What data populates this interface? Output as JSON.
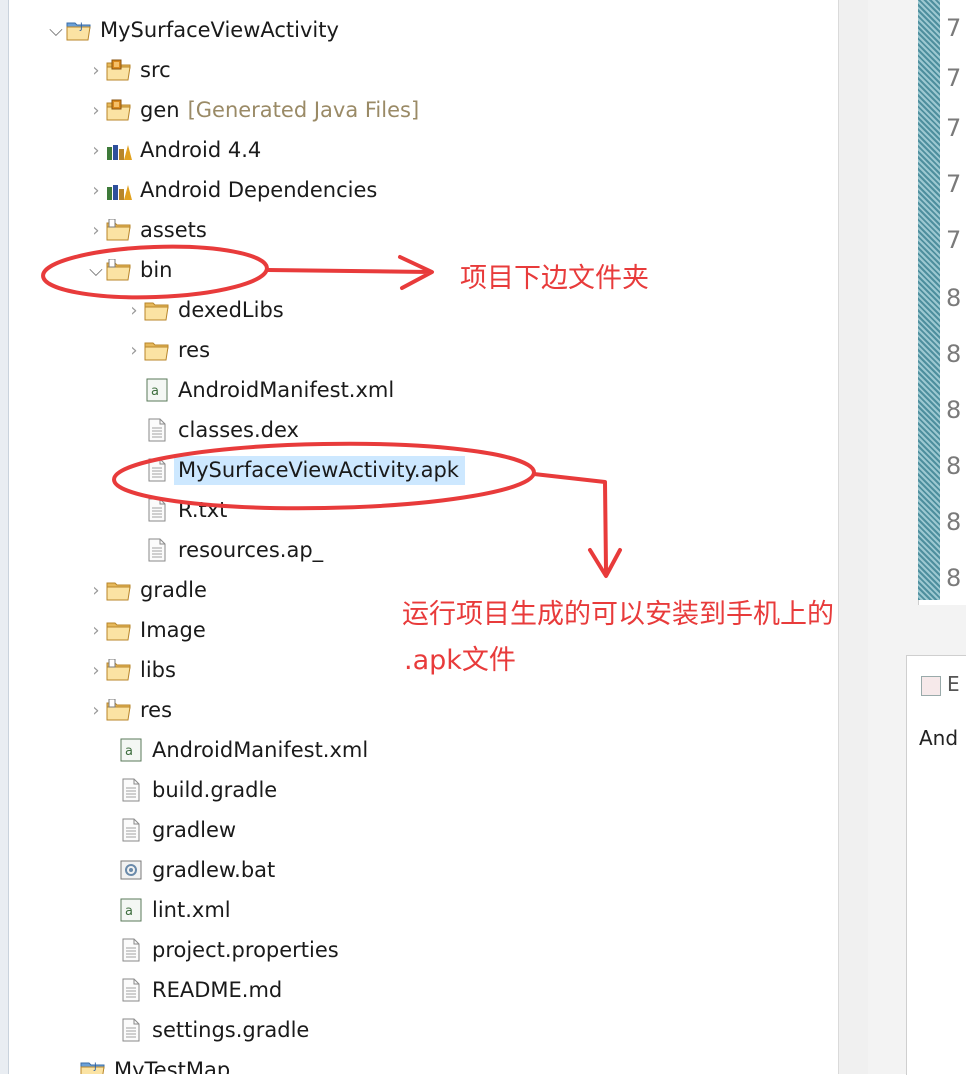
{
  "tree": {
    "project": "MySurfaceViewActivity",
    "src": "src",
    "gen": "gen",
    "gen_note": "[Generated Java Files]",
    "android44": "Android 4.4",
    "android_deps": "Android Dependencies",
    "assets": "assets",
    "bin": "bin",
    "dexedLibs": "dexedLibs",
    "bin_res": "res",
    "bin_manifest": "AndroidManifest.xml",
    "classes_dex": "classes.dex",
    "apk": "MySurfaceViewActivity.apk",
    "r_txt": "R.txt",
    "resources_ap": "resources.ap_",
    "gradle": "gradle",
    "image": "Image",
    "libs": "libs",
    "res": "res",
    "manifest": "AndroidManifest.xml",
    "build_gradle": "build.gradle",
    "gradlew": "gradlew",
    "gradlew_bat": "gradlew.bat",
    "lint_xml": "lint.xml",
    "project_properties": "project.properties",
    "readme": "README.md",
    "settings_gradle": "settings.gradle",
    "next_project": "MyTestMap"
  },
  "annotations": {
    "bin_note": "项目下边文件夹",
    "apk_note_line1": "运行项目生成的可以安装到手机上的",
    "apk_note_line2": ".apk文件"
  },
  "editor": {
    "line_char_a": "7",
    "line_char_b": "8",
    "bottom_tab_label": "E",
    "bottom_content": "And"
  },
  "colors": {
    "annotation": "#e83b3b",
    "selection": "#cde8ff",
    "folder": "#f2c45a",
    "decorator": "#e8a000"
  },
  "icons": {
    "project": "project-folder-icon",
    "source_folder": "source-folder-icon",
    "library": "library-icon",
    "folder": "folder-icon",
    "file": "file-icon",
    "xml": "xml-file-icon",
    "script": "script-file-icon"
  }
}
